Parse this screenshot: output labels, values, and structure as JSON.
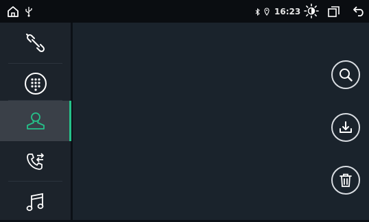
{
  "statusbar": {
    "time": "16:23",
    "icons": [
      "home-icon",
      "usb-icon",
      "bluetooth-icon",
      "location-icon",
      "brightness-icon",
      "window-icon",
      "back-icon"
    ]
  },
  "sidebar": {
    "items": [
      {
        "name": "link",
        "icon": "link-icon",
        "active": false
      },
      {
        "name": "dialpad",
        "icon": "dialpad-icon",
        "active": false
      },
      {
        "name": "contacts",
        "icon": "contact-icon",
        "active": true
      },
      {
        "name": "call-log",
        "icon": "call-log-icon",
        "active": false
      },
      {
        "name": "music",
        "icon": "music-icon",
        "active": false
      }
    ],
    "active_color": "#25c28a"
  },
  "actions": [
    {
      "name": "search",
      "icon": "search-icon"
    },
    {
      "name": "download",
      "icon": "download-icon"
    },
    {
      "name": "delete",
      "icon": "trash-icon"
    }
  ]
}
